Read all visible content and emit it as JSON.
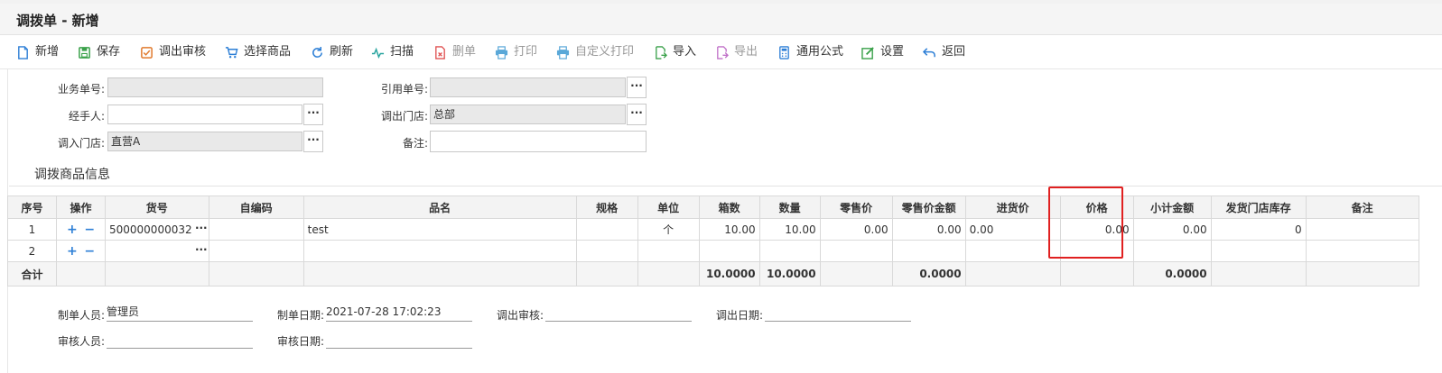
{
  "window": {
    "title": "调拨单 - 新增"
  },
  "toolbar": [
    {
      "label": "新增",
      "icon": "new-file-icon",
      "color": "#2d7fd6",
      "disabled": false
    },
    {
      "label": "保存",
      "icon": "save-icon",
      "color": "#3aa14a",
      "disabled": false
    },
    {
      "label": "调出审核",
      "icon": "checkbox-icon",
      "color": "#e07a2d",
      "disabled": false
    },
    {
      "label": "选择商品",
      "icon": "cart-icon",
      "color": "#2d7fd6",
      "disabled": false
    },
    {
      "label": "刷新",
      "icon": "refresh-icon",
      "color": "#2d7fd6",
      "disabled": false
    },
    {
      "label": "扫描",
      "icon": "pulse-icon",
      "color": "#2aa5a0",
      "disabled": false
    },
    {
      "label": "删单",
      "icon": "delete-file-icon",
      "color": "#e05050",
      "disabled": true
    },
    {
      "label": "打印",
      "icon": "printer-icon",
      "color": "#5aa8d8",
      "disabled": true
    },
    {
      "label": "自定义打印",
      "icon": "printer-icon",
      "color": "#5aa8d8",
      "disabled": true
    },
    {
      "label": "导入",
      "icon": "import-icon",
      "color": "#3aa14a",
      "disabled": false
    },
    {
      "label": "导出",
      "icon": "export-icon",
      "color": "#c070c8",
      "disabled": true
    },
    {
      "label": "通用公式",
      "icon": "calculator-icon",
      "color": "#2d7fd6",
      "disabled": false
    },
    {
      "label": "设置",
      "icon": "edit-settings-icon",
      "color": "#3aa14a",
      "disabled": false
    },
    {
      "label": "返回",
      "icon": "back-arrow-icon",
      "color": "#2d7fd6",
      "disabled": false
    }
  ],
  "form": {
    "business_no": {
      "label": "业务单号:",
      "value": ""
    },
    "handler": {
      "label": "经手人:",
      "value": ""
    },
    "in_store": {
      "label": "调入门店:",
      "value": "直营A"
    },
    "ref_no": {
      "label": "引用单号:",
      "value": ""
    },
    "out_store": {
      "label": "调出门店:",
      "value": "总部"
    },
    "remark": {
      "label": "备注:",
      "value": ""
    }
  },
  "section_title": "调拨商品信息",
  "grid": {
    "columns": [
      "序号",
      "操作",
      "货号",
      "自编码",
      "品名",
      "规格",
      "单位",
      "箱数",
      "数量",
      "零售价",
      "零售价金额",
      "进货价",
      "价格",
      "小计金额",
      "发货门店库存",
      "备注"
    ],
    "rows": [
      {
        "seq": "1",
        "code": "500000000032",
        "self_code": "",
        "name": "test",
        "spec": "",
        "unit": "个",
        "boxes": "10.00",
        "qty": "10.00",
        "retail": "0.00",
        "retail_amt": "0.00",
        "purchase": "0.00",
        "price": "0.00",
        "subtotal": "0.00",
        "stock": "0",
        "remark": ""
      },
      {
        "seq": "2",
        "code": "",
        "self_code": "",
        "name": "",
        "spec": "",
        "unit": "",
        "boxes": "",
        "qty": "",
        "retail": "",
        "retail_amt": "",
        "purchase": "",
        "price": "",
        "subtotal": "",
        "stock": "",
        "remark": ""
      }
    ],
    "total": {
      "label": "合计",
      "boxes": "10.0000",
      "qty": "10.0000",
      "retail_amt": "0.0000",
      "subtotal": "0.0000"
    },
    "op_plus": "+",
    "op_minus": "−",
    "dots": "···"
  },
  "footer": {
    "maker": {
      "label": "制单人员:",
      "value": "管理员"
    },
    "make_date": {
      "label": "制单日期:",
      "value": "2021-07-28 17:02:23"
    },
    "out_audit": {
      "label": "调出审核:",
      "value": ""
    },
    "out_date": {
      "label": "调出日期:",
      "value": ""
    },
    "auditor": {
      "label": "审核人员:",
      "value": ""
    },
    "audit_date": {
      "label": "审核日期:",
      "value": ""
    }
  },
  "colors": {
    "accent": "#2d7fd6",
    "highlight": "#e02020"
  }
}
